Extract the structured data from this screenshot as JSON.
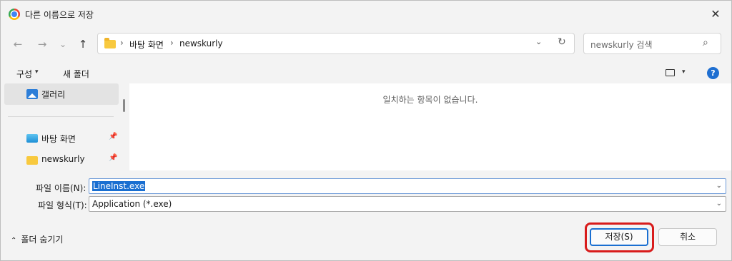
{
  "window": {
    "title": "다른 이름으로 저장",
    "close_icon": "close-icon"
  },
  "nav": {
    "back": "←",
    "forward": "→",
    "recent": "⌄",
    "up": "↑",
    "breadcrumb": [
      "바탕 화면",
      "newskurly"
    ],
    "separator": "›",
    "dropdown": "⌄",
    "refresh": "↻"
  },
  "search": {
    "placeholder": "newskurly 검색",
    "icon": "⌕"
  },
  "toolbar": {
    "organize": "구성",
    "organize_caret": "▾",
    "new_folder": "새 폴더",
    "view_caret": "▾",
    "help": "?"
  },
  "sidebar": {
    "items": [
      {
        "label": "갤러리",
        "icon": "gallery-icon",
        "selected": true,
        "pinned": false
      },
      {
        "label": "바탕 화면",
        "icon": "desktop-icon",
        "selected": false,
        "pinned": true
      },
      {
        "label": "newskurly",
        "icon": "folder-icon",
        "selected": false,
        "pinned": true
      }
    ],
    "pin_glyph": "📌"
  },
  "file_list": {
    "empty_message": "일치하는 항목이 없습니다."
  },
  "fields": {
    "filename_label": "파일 이름(N):",
    "filename_value": "LineInst.exe",
    "filetype_label": "파일 형식(T):",
    "filetype_value": "Application (*.exe)",
    "caret": "⌄"
  },
  "footer": {
    "hide_folders_caret": "⌃",
    "hide_folders": "폴더 숨기기",
    "save": "저장(S)",
    "cancel": "취소"
  },
  "colors": {
    "accent": "#1a6fd1",
    "highlight": "#d81b1b",
    "background": "#f3f3f3"
  }
}
